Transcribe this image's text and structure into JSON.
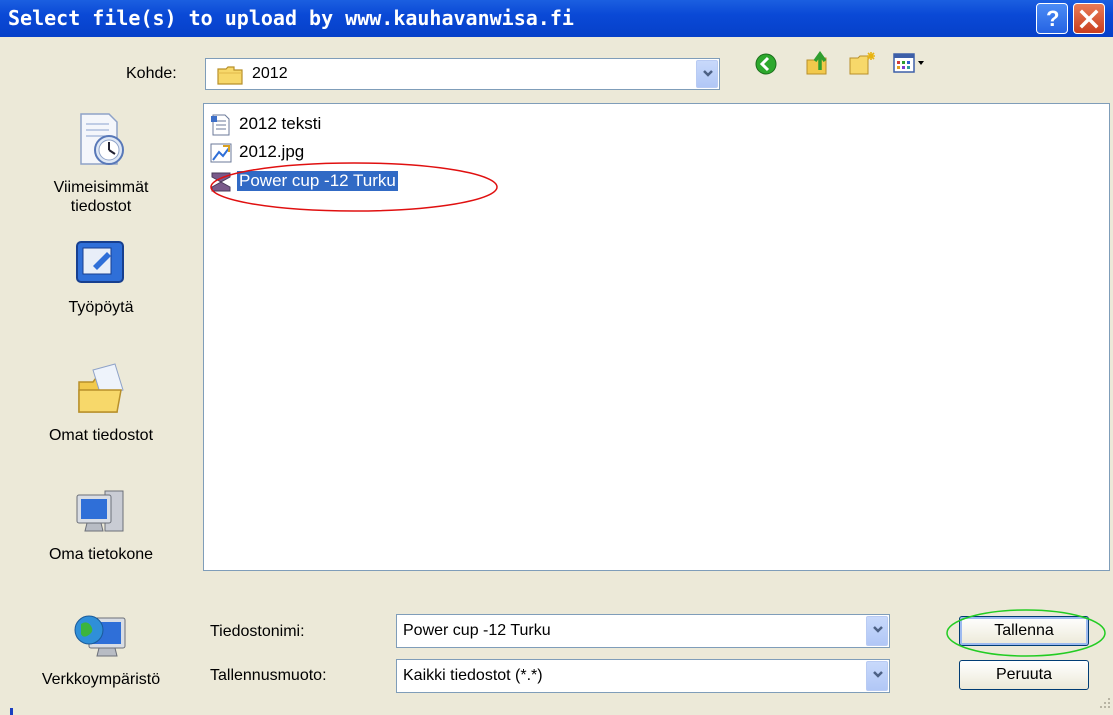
{
  "window": {
    "title": "Select file(s) to upload by www.kauhavanwisa.fi",
    "help_label": "?"
  },
  "lookin": {
    "label": "Kohde:",
    "value": "2012"
  },
  "toolbar": {
    "back_icon": "back-arrow-icon",
    "up_icon": "up-folder-icon",
    "new_folder_icon": "new-folder-icon",
    "views_icon": "views-menu-icon"
  },
  "places": [
    {
      "label": "Viimeisimmät tiedostot",
      "icon": "recent-documents-icon"
    },
    {
      "label": "Työpöytä",
      "icon": "desktop-icon"
    },
    {
      "label": "Omat tiedostot",
      "icon": "my-documents-icon"
    },
    {
      "label": "Oma tietokone",
      "icon": "my-computer-icon"
    },
    {
      "label": "Verkkoympäristö",
      "icon": "network-icon"
    }
  ],
  "files": [
    {
      "name": "2012 teksti",
      "icon": "text-document-icon",
      "selected": false
    },
    {
      "name": "2012.jpg",
      "icon": "image-file-icon",
      "selected": false
    },
    {
      "name": "Power cup -12 Turku",
      "icon": "file-icon",
      "selected": true
    }
  ],
  "filename": {
    "label": "Tiedostonimi:",
    "value": "Power cup -12 Turku"
  },
  "filetype": {
    "label": "Tallennusmuoto:",
    "value": "Kaikki tiedostot (*.*)"
  },
  "buttons": {
    "save": "Tallenna",
    "cancel": "Peruuta"
  },
  "colors": {
    "titlebar": "#0a49d6",
    "selection": "#316ac5",
    "annotation_red": "#e01010",
    "annotation_green": "#22cc22"
  }
}
